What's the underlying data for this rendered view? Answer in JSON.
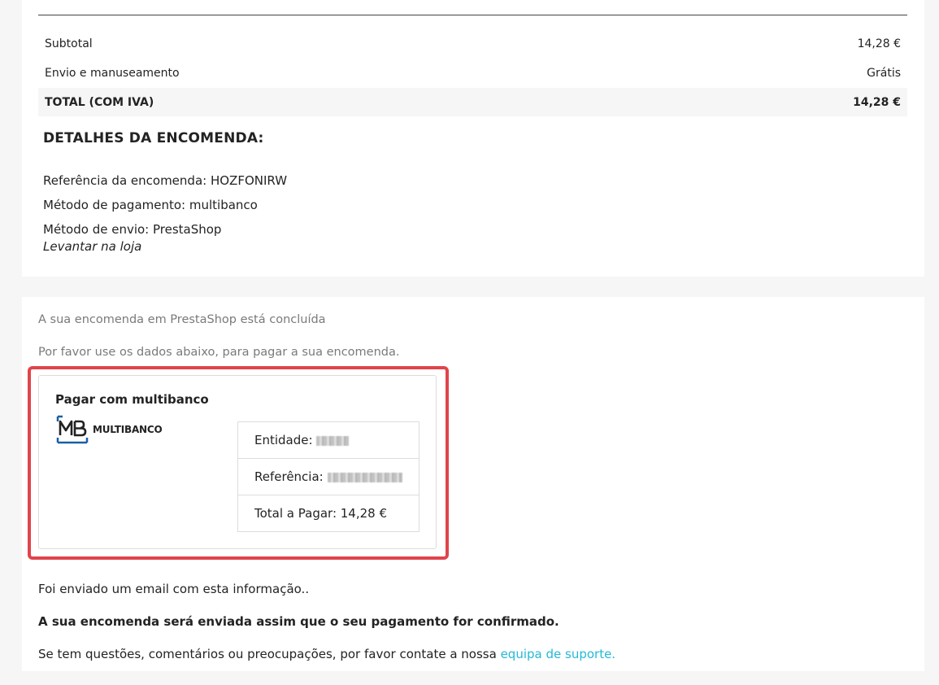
{
  "totals": {
    "subtotal_label": "Subtotal",
    "subtotal_value": "14,28 €",
    "shipping_label": "Envio e manuseamento",
    "shipping_value": "Grátis",
    "total_label": "TOTAL (COM IVA)",
    "total_value": "14,28 €"
  },
  "details": {
    "heading": "DETALHES DA ENCOMENDA:",
    "reference": "Referência da encomenda: HOZFONIRW",
    "payment_method": "Método de pagamento: multibanco",
    "shipping_method": "Método de envio: PrestaShop",
    "shipping_note": "Levantar na loja"
  },
  "confirmation": {
    "message1": "A sua encomenda em PrestaShop está concluída",
    "message2": "Por favor use os dados abaixo, para pagar a sua encomenda."
  },
  "multibanco": {
    "title": "Pagar com multibanco",
    "logo_text": "MULTIBANCO",
    "entity_label": "Entidade:",
    "reference_label": "Referência:",
    "total_label": "Total a Pagar: 14,28 €"
  },
  "footer": {
    "email_sent": "Foi enviado um email com esta informação..",
    "shipping_notice": "A sua encomenda será enviada assim que o seu pagamento for confirmado.",
    "questions": "Se tem questões, comentários ou preocupações, por favor contate a nossa",
    "support_link": "equipa de suporte."
  },
  "colors": {
    "highlight": "#e0444b",
    "link": "#24b9d7",
    "mb_blue": "#1a5fa6"
  }
}
